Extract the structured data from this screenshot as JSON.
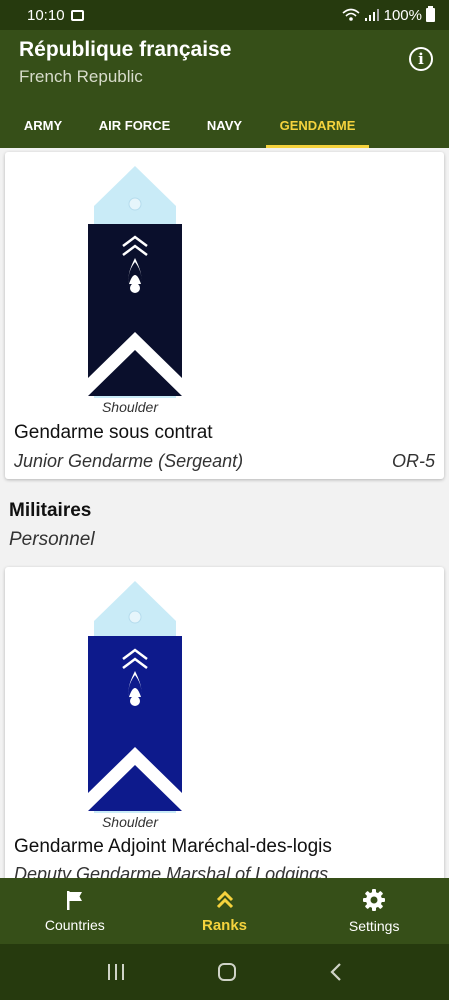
{
  "status": {
    "time": "10:10",
    "battery": "100%"
  },
  "header": {
    "title": "République française",
    "subtitle": "French Republic"
  },
  "tabs": [
    {
      "label": "ARMY",
      "active": false
    },
    {
      "label": "AIR FORCE",
      "active": false
    },
    {
      "label": "NAVY",
      "active": false
    },
    {
      "label": "GENDARME",
      "active": true
    }
  ],
  "cards": [
    {
      "caption": "Shoulder",
      "name": "Gendarme sous contrat",
      "translation": "Junior Gendarme (Sergeant)",
      "code": "OR-5",
      "board_color": "#0a0f2c"
    },
    {
      "caption": "Shoulder",
      "name": "Gendarme Adjoint Maréchal-des-logis",
      "translation": "Deputy Gendarme Marshal of Lodgings",
      "code": "",
      "board_color": "#0d1a8c"
    }
  ],
  "section": {
    "title": "Militaires",
    "subtitle": "Personnel"
  },
  "bottom_nav": [
    {
      "label": "Countries",
      "icon": "flag-icon",
      "active": false
    },
    {
      "label": "Ranks",
      "icon": "chevrons-up-icon",
      "active": true
    },
    {
      "label": "Settings",
      "icon": "gear-icon",
      "active": false
    }
  ],
  "colors": {
    "app_bar": "#364f18",
    "status_bar": "#263a0e",
    "accent": "#f5d33d",
    "epaulette_tip": "#c9ebf7"
  }
}
